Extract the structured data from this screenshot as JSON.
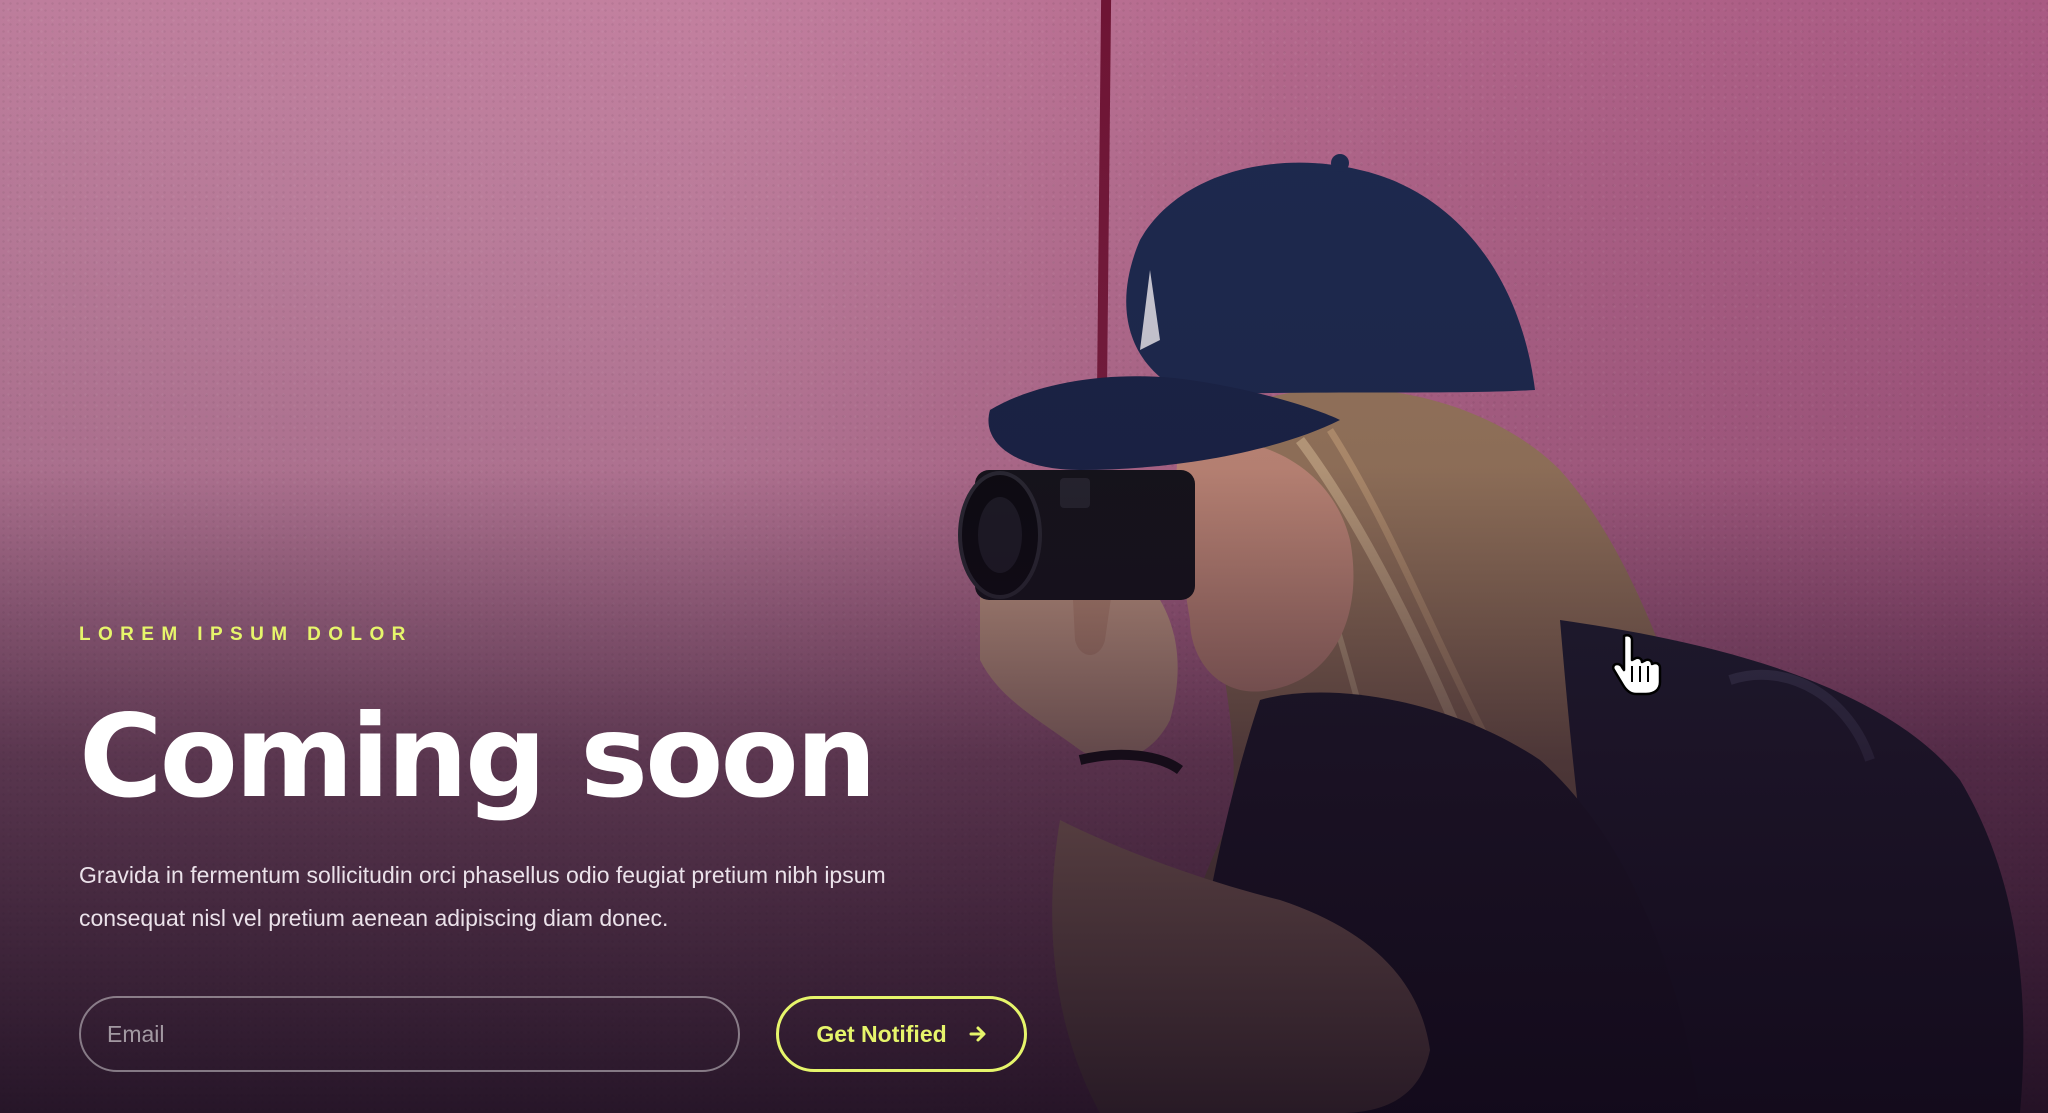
{
  "hero": {
    "eyebrow": "LOREM IPSUM DOLOR",
    "title": "Coming soon",
    "description": "Gravida in fermentum sollicitudin orci phasellus odio feugiat pretium nibh ipsum consequat nisl vel pretium aenean adipiscing diam donec."
  },
  "form": {
    "email_placeholder": "Email",
    "email_value": "",
    "button_label": "Get Notified",
    "button_icon": "arrow-right-icon"
  },
  "colors": {
    "accent": "#e6f56b",
    "title": "#ffffff",
    "background": "#bb7898"
  },
  "cursor": "hand-pointer-icon"
}
